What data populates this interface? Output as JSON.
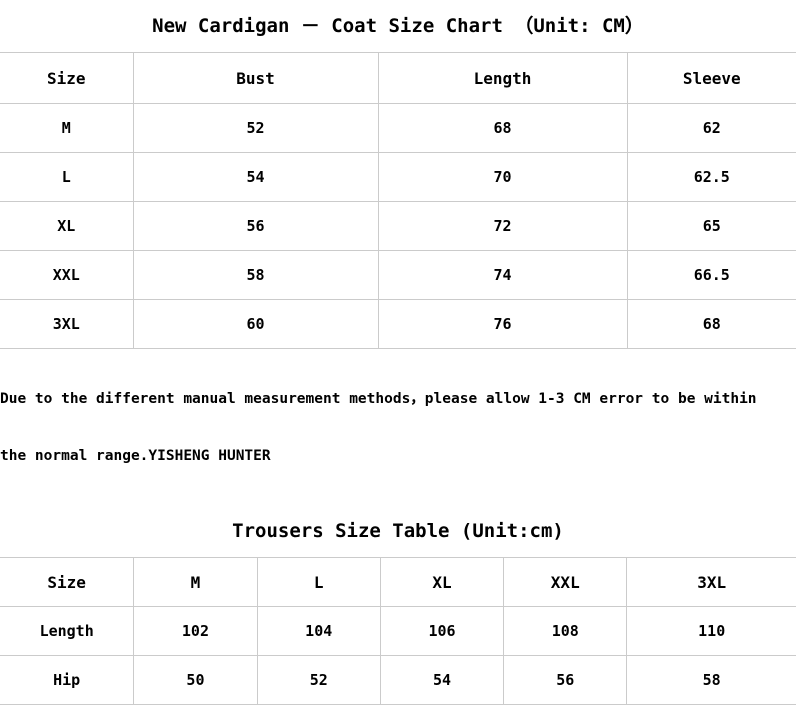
{
  "coat_section": {
    "title": "New Cardigan － Coat Size Chart （Unit: CM）",
    "headers": [
      "Size",
      "Bust",
      "Length",
      "Sleeve"
    ],
    "rows": [
      {
        "size": "M",
        "bust": "52",
        "length": "68",
        "sleeve": "62"
      },
      {
        "size": "L",
        "bust": "54",
        "length": "70",
        "sleeve": "62.5"
      },
      {
        "size": "XL",
        "bust": "56",
        "length": "72",
        "sleeve": "65"
      },
      {
        "size": "XXL",
        "bust": "58",
        "length": "74",
        "sleeve": "66.5"
      },
      {
        "size": "3XL",
        "bust": "60",
        "length": "76",
        "sleeve": "68"
      }
    ]
  },
  "note": {
    "line1": "Due to the different manual measurement methods，please allow 1-3 CM error to be within",
    "line2": "the normal range.YISHENG HUNTER"
  },
  "trousers_section": {
    "title": "Trousers Size Table (Unit:cm)",
    "headers": [
      "Size",
      "M",
      "L",
      "XL",
      "XXL",
      "3XL"
    ],
    "rows": [
      {
        "label": "Length",
        "m": "102",
        "l": "104",
        "xl": "106",
        "xxl": "108",
        "xxxl": "110"
      },
      {
        "label": "Hip",
        "m": "50",
        "l": "52",
        "xl": "54",
        "xxl": "56",
        "xxxl": "58"
      }
    ]
  },
  "colors": {
    "text": "#000000",
    "border": "#cbcbcb",
    "background": "#ffffff"
  },
  "chart_data": {
    "type": "table",
    "title": "New Cardigan － Coat Size Chart （Unit: CM）",
    "tables": [
      {
        "name": "coat",
        "title": "New Cardigan － Coat Size Chart （Unit: CM）",
        "unit": "CM",
        "columns": [
          "Size",
          "Bust",
          "Length",
          "Sleeve"
        ],
        "rows": [
          [
            "M",
            52,
            68,
            62
          ],
          [
            "L",
            54,
            70,
            62.5
          ],
          [
            "XL",
            56,
            72,
            65
          ],
          [
            "XXL",
            58,
            74,
            66.5
          ],
          [
            "3XL",
            60,
            76,
            68
          ]
        ],
        "note": "Due to the different manual measurement methods，please allow 1-3 CM error to be within the normal range.YISHENG HUNTER"
      },
      {
        "name": "trousers",
        "title": "Trousers Size Table (Unit:cm)",
        "unit": "cm",
        "columns": [
          "Size",
          "M",
          "L",
          "XL",
          "XXL",
          "3XL"
        ],
        "rows": [
          [
            "Length",
            102,
            104,
            106,
            108,
            110
          ],
          [
            "Hip",
            50,
            52,
            54,
            56,
            58
          ]
        ]
      }
    ]
  }
}
